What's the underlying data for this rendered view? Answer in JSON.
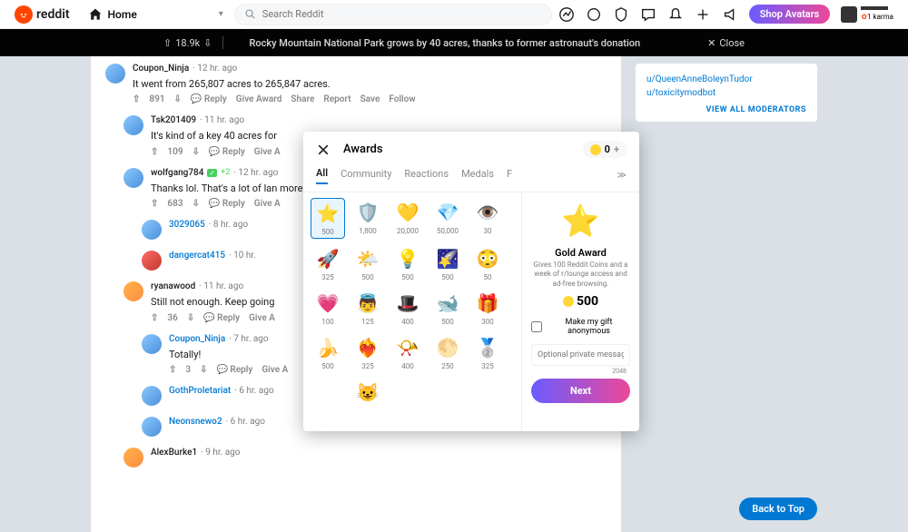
{
  "header": {
    "logo_text": "reddit",
    "home": "Home",
    "search_placeholder": "Search Reddit",
    "shop_avatars": "Shop Avatars",
    "karma": "1 karma"
  },
  "postbar": {
    "score": "18.9k",
    "title": "Rocky Mountain National Park grows by 40 acres, thanks to former astronaut's donation",
    "close": "Close"
  },
  "sidebar": {
    "mods": [
      "u/QueenAnneBoleynTudor",
      "u/toxicitymodbot"
    ],
    "view_all": "VIEW ALL MODERATORS"
  },
  "comments": [
    {
      "user": "Coupon_Ninja",
      "time": "12 hr. ago",
      "text": "It went from 265,807 acres to 265,847 acres.",
      "score": "891",
      "indent": 0,
      "avatar": "blue"
    },
    {
      "user": "Tsk201409",
      "time": "11 hr. ago",
      "text": "It's kind of a key 40 acres for",
      "score": "109",
      "indent": 1,
      "avatar": "blue"
    },
    {
      "user": "wolfgang784",
      "time": "12 hr. ago",
      "badge": "+2",
      "text": "Thanks lol. That's a lot of lan more protected land is more",
      "score": "683",
      "indent": 1,
      "avatar": "blue"
    },
    {
      "user": "3029065",
      "time": "8 hr. ago",
      "text": "",
      "score": "",
      "indent": 2,
      "avatar": "blue"
    },
    {
      "user": "dangercat415",
      "time": "10 hr.",
      "text": "",
      "score": "",
      "indent": 2,
      "avatar": "red"
    },
    {
      "user": "ryanawood",
      "time": "11 hr. ago",
      "text": "Still not enough. Keep going",
      "score": "36",
      "indent": 1,
      "avatar": "orange"
    },
    {
      "user": "Coupon_Ninja",
      "time": "7 hr. ago",
      "text": "Totally!",
      "score": "3",
      "indent": 2,
      "avatar": "blue"
    },
    {
      "user": "GothProletariat",
      "time": "6 hr. ago",
      "text": "",
      "score": "",
      "indent": 2,
      "avatar": "blue"
    },
    {
      "user": "Neonsnewo2",
      "time": "6 hr. ago",
      "text": "",
      "score": "",
      "indent": 2,
      "avatar": "blue"
    },
    {
      "user": "AlexBurke1",
      "time": "9 hr. ago",
      "text": "",
      "score": "",
      "indent": 1,
      "avatar": "orange"
    }
  ],
  "actions": {
    "reply": "Reply",
    "give_award": "Give Award",
    "share": "Share",
    "report": "Report",
    "save": "Save",
    "follow": "Follow"
  },
  "award_modal": {
    "title": "Awards",
    "coin_balance": "0",
    "tabs": [
      "All",
      "Community",
      "Reactions",
      "Medals",
      "F"
    ],
    "grid": [
      [
        {
          "emoji": "⭐",
          "cost": "500",
          "selected": true
        },
        {
          "emoji": "🛡️",
          "cost": "1,800"
        },
        {
          "emoji": "💛",
          "cost": "20,000"
        },
        {
          "emoji": "💎",
          "cost": "50,000"
        },
        {
          "emoji": "👁️",
          "cost": "30"
        }
      ],
      [
        {
          "emoji": "🚀",
          "cost": "325"
        },
        {
          "emoji": "🌤️",
          "cost": "500"
        },
        {
          "emoji": "💡",
          "cost": "500"
        },
        {
          "emoji": "🌠",
          "cost": "500"
        },
        {
          "emoji": "😳",
          "cost": "50"
        }
      ],
      [
        {
          "emoji": "💗",
          "cost": "100"
        },
        {
          "emoji": "👼",
          "cost": "125"
        },
        {
          "emoji": "🎩",
          "cost": "400"
        },
        {
          "emoji": "🐋",
          "cost": "500"
        },
        {
          "emoji": "🎁",
          "cost": "300"
        }
      ],
      [
        {
          "emoji": "🍌",
          "cost": "500"
        },
        {
          "emoji": "❤️‍🔥",
          "cost": "325"
        },
        {
          "emoji": "📯",
          "cost": "400"
        },
        {
          "emoji": "🌕",
          "cost": "250"
        },
        {
          "emoji": "🥈",
          "cost": "325"
        }
      ],
      [
        {
          "emoji": "",
          "cost": ""
        },
        {
          "emoji": "😺",
          "cost": ""
        },
        {
          "emoji": "",
          "cost": ""
        },
        {
          "emoji": "",
          "cost": ""
        },
        {
          "emoji": "",
          "cost": ""
        }
      ]
    ],
    "detail": {
      "name": "Gold Award",
      "desc": "Gives 100 Reddit Coins and a week of r/lounge access and ad-free browsing.",
      "cost": "500",
      "anon_label": "Make my gift anonymous",
      "msg_placeholder": "Optional private message",
      "msg_max": "2048",
      "next": "Next"
    }
  },
  "back_to_top": "Back to Top"
}
